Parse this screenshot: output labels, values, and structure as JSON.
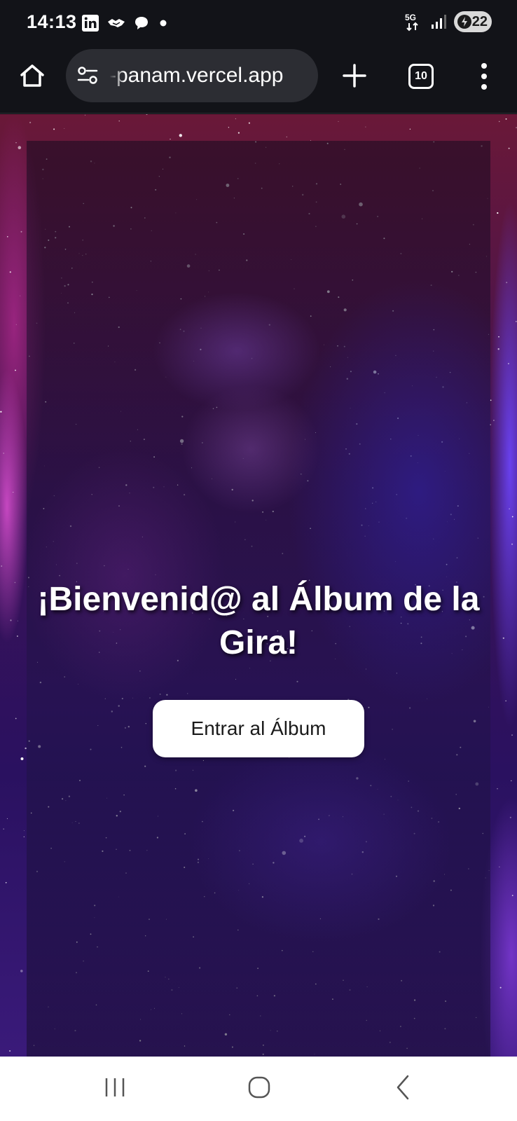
{
  "status_bar": {
    "time": "14:13",
    "left_icons": [
      "linkedin-icon",
      "handshake-icon",
      "chat-bubble-icon",
      "notification-dot-icon"
    ],
    "network_label": "5G",
    "battery_level": "22"
  },
  "browser": {
    "url": "-panam.vercel.app",
    "tab_count": "10",
    "icons": [
      "home-icon",
      "site-settings-icon",
      "new-tab-plus-icon",
      "tab-switcher-icon",
      "more-menu-icon"
    ]
  },
  "page": {
    "title": "¡Bienvenid@ al Álbum de la Gira!",
    "button_label": "Entrar al Álbum"
  },
  "nav_bar": {
    "icons": [
      "recents-icon",
      "home-circle-icon",
      "back-icon"
    ]
  },
  "colors": {
    "chrome_bg": "#121318",
    "url_pill_bg": "#2c2d33",
    "button_bg": "#ffffff",
    "title_text": "#ffffff"
  }
}
